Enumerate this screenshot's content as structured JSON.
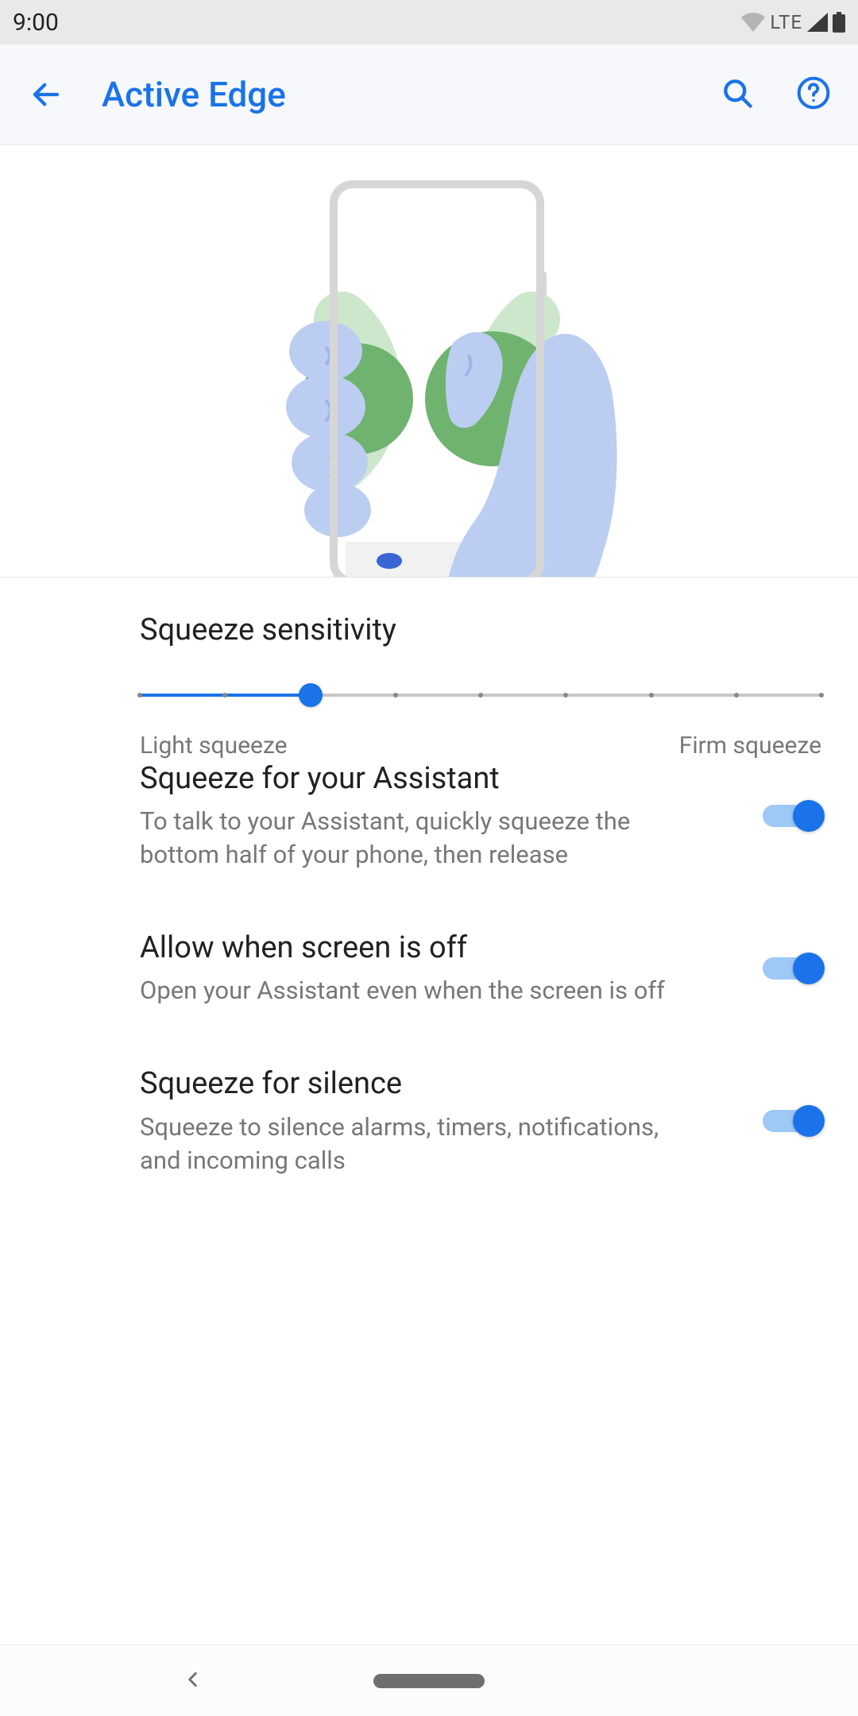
{
  "status": {
    "time": "9:00",
    "network": "LTE"
  },
  "header": {
    "title": "Active Edge"
  },
  "slider": {
    "title": "Squeeze sensitivity",
    "min_label": "Light squeeze",
    "max_label": "Firm squeeze",
    "steps": 9,
    "value_index": 2
  },
  "settings": [
    {
      "title": "Squeeze for your Assistant",
      "subtitle": "To talk to your Assistant, quickly squeeze the bottom half of your phone, then release",
      "enabled": true
    },
    {
      "title": "Allow when screen is off",
      "subtitle": "Open your Assistant even when the screen is off",
      "enabled": true
    },
    {
      "title": "Squeeze for silence",
      "subtitle": "Squeeze to silence alarms, timers, notifications, and incoming calls",
      "enabled": true
    }
  ]
}
